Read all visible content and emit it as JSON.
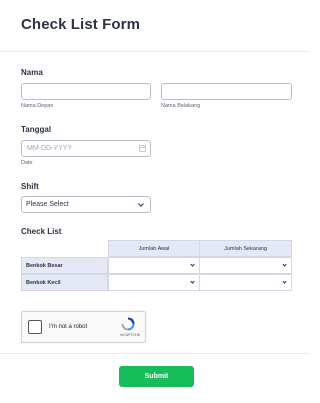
{
  "form": {
    "title": "Check List Form",
    "nama": {
      "label": "Nama",
      "first": {
        "value": "",
        "sublabel": "Nama Depan"
      },
      "last": {
        "value": "",
        "sublabel": "Nama Belakang"
      }
    },
    "tanggal": {
      "label": "Tanggal",
      "placeholder": "MM-DD-YYYY",
      "sublabel": "Date"
    },
    "shift": {
      "label": "Shift",
      "selected": "Please Select"
    },
    "checklist": {
      "label": "Check List",
      "columns": [
        "Jumlah Awal",
        "Jumlah Sekarang"
      ],
      "rows": [
        "Benkok Besar",
        "Benkok Kecil"
      ]
    },
    "captcha": {
      "text": "I'm not a robot",
      "brand": "reCAPTCHA"
    },
    "submit_label": "Submit"
  },
  "colors": {
    "submit": "#18bd5b",
    "matrix_header": "#e5e8f5",
    "text": "#2c3345"
  }
}
